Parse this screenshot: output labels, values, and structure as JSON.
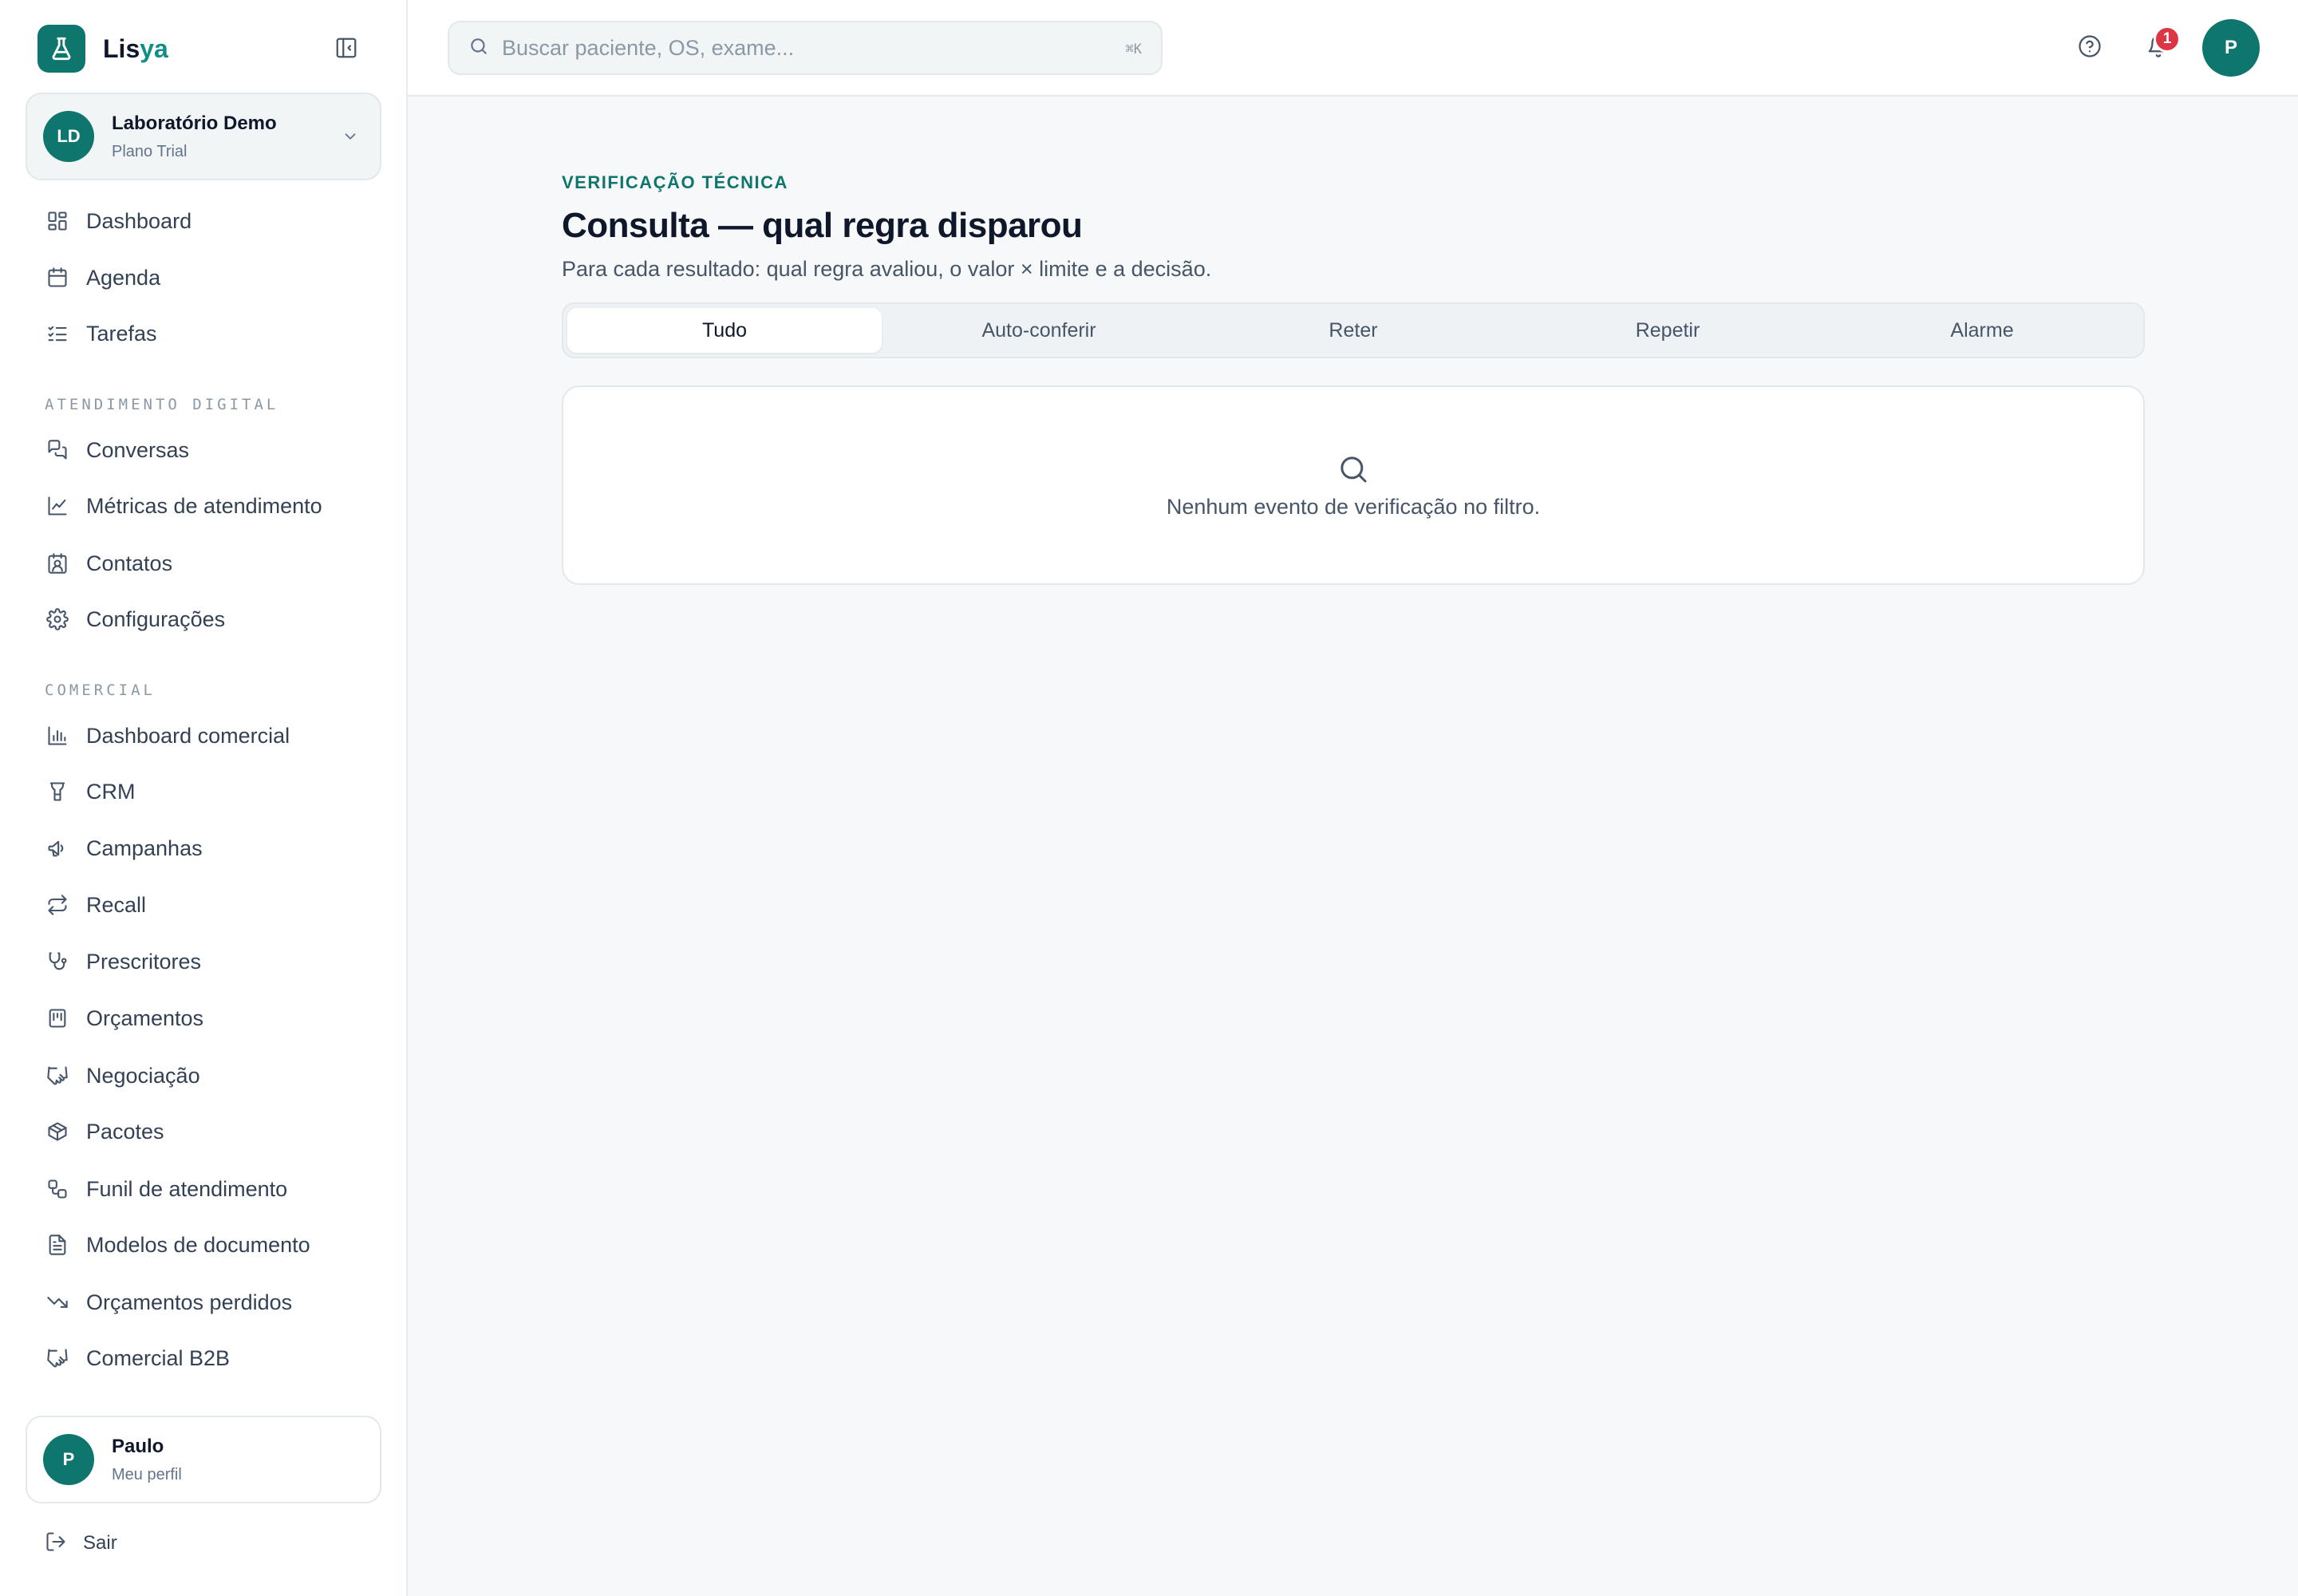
{
  "brand": {
    "name_part1": "Lis",
    "name_part2": "ya"
  },
  "org": {
    "initials": "LD",
    "name": "Laboratório Demo",
    "plan": "Plano Trial"
  },
  "nav_main": [
    {
      "label": "Dashboard",
      "icon": "layout-dashboard-icon"
    },
    {
      "label": "Agenda",
      "icon": "calendar-icon"
    },
    {
      "label": "Tarefas",
      "icon": "list-checks-icon"
    }
  ],
  "section_digital": "ATENDIMENTO DIGITAL",
  "nav_digital": [
    {
      "label": "Conversas",
      "icon": "messages-icon"
    },
    {
      "label": "Métricas de atendimento",
      "icon": "line-chart-icon"
    },
    {
      "label": "Contatos",
      "icon": "contact-icon"
    },
    {
      "label": "Configurações",
      "icon": "gear-icon"
    }
  ],
  "section_comercial": "COMERCIAL",
  "nav_comercial": [
    {
      "label": "Dashboard comercial",
      "icon": "bar-chart-icon"
    },
    {
      "label": "CRM",
      "icon": "funnel-icon"
    },
    {
      "label": "Campanhas",
      "icon": "megaphone-icon"
    },
    {
      "label": "Recall",
      "icon": "repeat-icon"
    },
    {
      "label": "Prescritores",
      "icon": "stethoscope-icon"
    },
    {
      "label": "Orçamentos",
      "icon": "calculator-icon"
    },
    {
      "label": "Negociação",
      "icon": "handshake-icon"
    },
    {
      "label": "Pacotes",
      "icon": "package-icon"
    },
    {
      "label": "Funil de atendimento",
      "icon": "workflow-icon"
    },
    {
      "label": "Modelos de documento",
      "icon": "file-text-icon"
    },
    {
      "label": "Orçamentos perdidos",
      "icon": "trending-down-icon"
    },
    {
      "label": "Comercial B2B",
      "icon": "handshake-icon"
    }
  ],
  "user": {
    "initial": "P",
    "name": "Paulo",
    "sub": "Meu perfil"
  },
  "logout_label": "Sair",
  "search": {
    "placeholder": "Buscar paciente, OS, exame...",
    "shortcut": "⌘K"
  },
  "notifications": {
    "count": "1"
  },
  "top_avatar": "P",
  "page": {
    "eyebrow": "VERIFICAÇÃO TÉCNICA",
    "title": "Consulta — qual regra disparou",
    "subtitle": "Para cada resultado: qual regra avaliou, o valor × limite e a decisão."
  },
  "tabs": [
    {
      "label": "Tudo",
      "active": true
    },
    {
      "label": "Auto-conferir",
      "active": false
    },
    {
      "label": "Reter",
      "active": false
    },
    {
      "label": "Repetir",
      "active": false
    },
    {
      "label": "Alarme",
      "active": false
    }
  ],
  "empty_state": {
    "message": "Nenhum evento de verificação no filtro."
  },
  "colors": {
    "primary": "#0f766e",
    "accent": "#0f8f86",
    "badge": "#dc3545",
    "background": "#f6f8f9"
  }
}
